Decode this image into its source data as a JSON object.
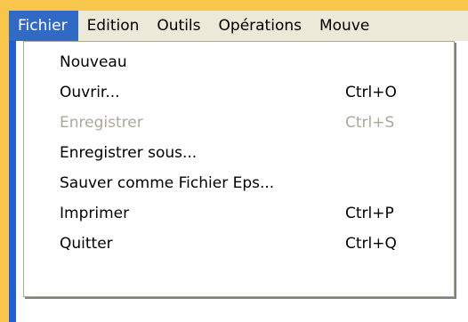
{
  "menu_bar": {
    "items": [
      {
        "label": "Fichier"
      },
      {
        "label": "Edition"
      },
      {
        "label": "Outils"
      },
      {
        "label": "Opérations"
      },
      {
        "label": "Mouve"
      }
    ]
  },
  "file_menu": {
    "items": [
      {
        "label": "Nouveau",
        "shortcut": ""
      },
      {
        "label": "Ouvrir...",
        "shortcut": "Ctrl+O"
      },
      {
        "label": "Enregistrer",
        "shortcut": "Ctrl+S",
        "disabled": true
      },
      {
        "label": "Enregistrer sous...",
        "shortcut": ""
      },
      {
        "label": "Sauver comme Fichier Eps...",
        "shortcut": ""
      },
      {
        "label": "Imprimer",
        "shortcut": "Ctrl+P"
      },
      {
        "label": "Quitter",
        "shortcut": "Ctrl+Q"
      }
    ]
  },
  "colors": {
    "background": "#f7c64a",
    "menu_highlight": "#316ac5",
    "menu_bar": "#ece9d8",
    "disabled_text": "#aca899",
    "side_strip": "#1d5fd6"
  }
}
